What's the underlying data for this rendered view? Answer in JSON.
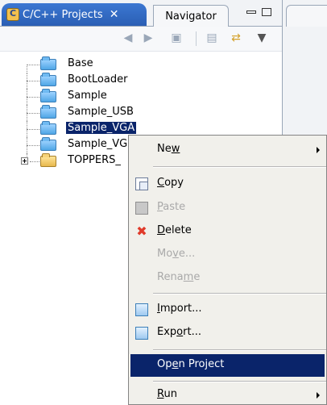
{
  "view": {
    "active_tab_label": "C/C++ Projects",
    "active_tab_close": "✕",
    "inactive_tab_label": "Navigator"
  },
  "toolbar": {
    "icons": [
      "back-arrow-icon",
      "forward-arrow-icon",
      "up-folder-icon",
      "collapse-all-icon",
      "link-with-editor-icon",
      "view-menu-icon"
    ]
  },
  "tree": {
    "items": [
      {
        "label": "Base"
      },
      {
        "label": "BootLoader"
      },
      {
        "label": "Sample"
      },
      {
        "label": "Sample_USB"
      },
      {
        "label": "Sample_VGA",
        "selected": true
      },
      {
        "label": "Sample_VG"
      },
      {
        "label": "TOPPERS_"
      }
    ]
  },
  "context_menu": {
    "new": {
      "pre": "Ne",
      "u": "w",
      "post": ""
    },
    "copy": {
      "pre": "",
      "u": "C",
      "post": "opy"
    },
    "paste": {
      "pre": "",
      "u": "P",
      "post": "aste"
    },
    "delete": {
      "pre": "",
      "u": "D",
      "post": "elete"
    },
    "move": {
      "pre": "Mo",
      "u": "v",
      "post": "e..."
    },
    "rename": {
      "pre": "Rena",
      "u": "m",
      "post": "e"
    },
    "import": {
      "pre": "",
      "u": "I",
      "post": "mport..."
    },
    "export": {
      "pre": "Exp",
      "u": "o",
      "post": "rt..."
    },
    "open_project": {
      "pre": "Op",
      "u": "e",
      "post": "n Project"
    },
    "run": {
      "pre": "",
      "u": "R",
      "post": "un"
    }
  },
  "colors": {
    "selection": "#0a246a",
    "tab_active": "#2a5fb4",
    "menu_bg": "#f1f0eb"
  }
}
